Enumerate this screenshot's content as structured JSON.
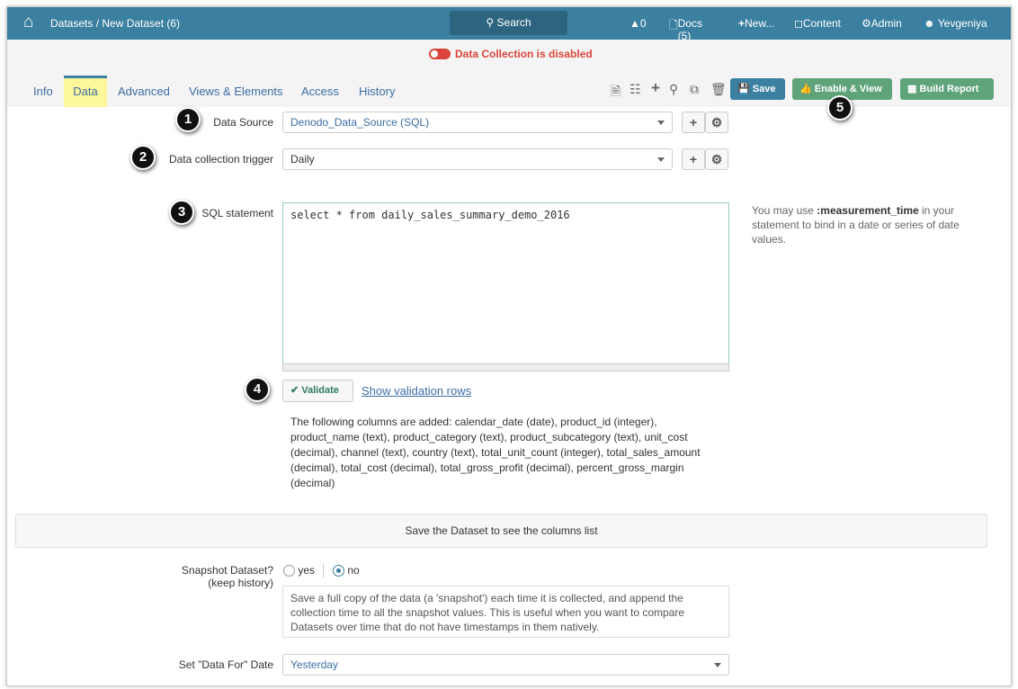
{
  "header": {
    "breadcrumb": "Datasets / New Dataset (6)",
    "search": "Search",
    "alerts": "0",
    "docs": "Docs (5)",
    "new": "New...",
    "content": "Content",
    "admin": "Admin",
    "user": "Yevgeniya"
  },
  "status": {
    "text": "Data Collection is disabled",
    "color": "#d9453b"
  },
  "tabs": [
    "Info",
    "Data",
    "Advanced",
    "Views & Elements",
    "Access",
    "History"
  ],
  "toolbar": {
    "save": "Save",
    "enable_view": "Enable & View",
    "build_report": "Build Report"
  },
  "form": {
    "data_source_label": "Data Source",
    "data_source": "Denodo_Data_Source (SQL)",
    "trigger_label": "Data collection trigger",
    "trigger": "Daily",
    "sql_label": "SQL statement",
    "sql": "select * from daily_sales_summary_demo_2016",
    "sql_help_pre": "You may use ",
    "sql_help_bold": ":measurement_time",
    "sql_help_post": " in your statement to bind in a date or series of date values.",
    "validate": "Validate",
    "show_rows": "Show validation rows",
    "columns_added": "The following columns are added: calendar_date (date), product_id (integer), product_name (text), product_category (text), product_subcategory (text), unit_cost (decimal), channel (text), country (text), total_unit_count (integer), total_sales_amount (decimal), total_cost (decimal), total_gross_profit (decimal), percent_gross_margin (decimal)",
    "columns_panel": "Save the Dataset to see the columns list",
    "snapshot_label": "Snapshot Dataset?",
    "snapshot_sub": "(keep history)",
    "yes": "yes",
    "no": "no",
    "snapshot_desc": "Save a full copy of the data (a 'snapshot') each time it is collected, and append the collection time to all the snapshot values. This is useful when you want to compare Datasets over time that do not have timestamps in them natively.",
    "data_for_label": "Set \"Data For\" Date",
    "data_for": "Yesterday"
  },
  "callouts": [
    "1",
    "2",
    "3",
    "4",
    "5"
  ]
}
